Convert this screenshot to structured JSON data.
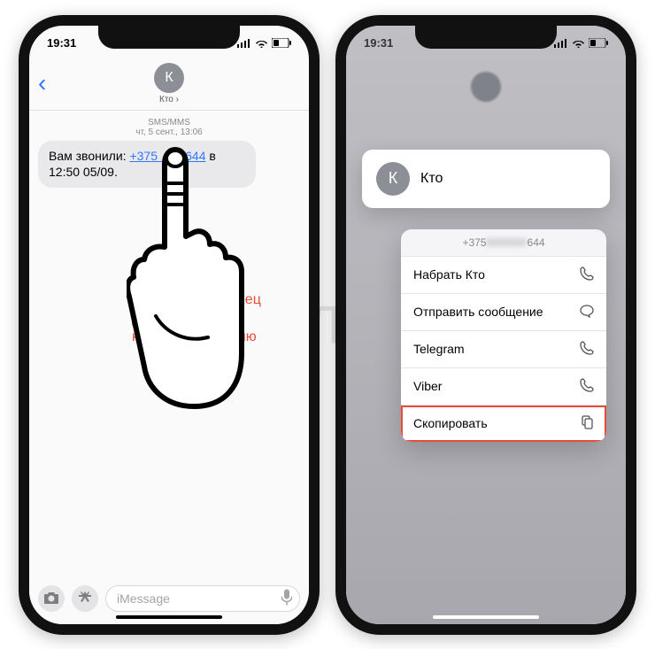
{
  "statusbar": {
    "time": "19:31"
  },
  "left": {
    "contact_initial": "К",
    "contact_name": "Кто ›",
    "thread_type": "SMS/MMS",
    "thread_date": "чт, 5 сент., 13:06",
    "bubble_prefix": "Вам звонили: ",
    "phone_visible_start": "+375",
    "phone_visible_end": "644",
    "bubble_suffix": " в 12:50 05/09.",
    "instruction": "Нажмите и удерживайте палец до появления контекстного меню",
    "input_placeholder": "iMessage"
  },
  "right": {
    "contact_initial": "К",
    "contact_name": "Кто",
    "menu_header_start": "+375",
    "menu_header_end": "644",
    "items": [
      {
        "label": "Набрать Кто",
        "icon": "phone"
      },
      {
        "label": "Отправить сообщение",
        "icon": "message"
      },
      {
        "label": "Telegram",
        "icon": "phone"
      },
      {
        "label": "Viber",
        "icon": "phone"
      },
      {
        "label": "Скопировать",
        "icon": "copy",
        "highlight": true
      }
    ]
  },
  "watermark": "ЯБЛЫК"
}
